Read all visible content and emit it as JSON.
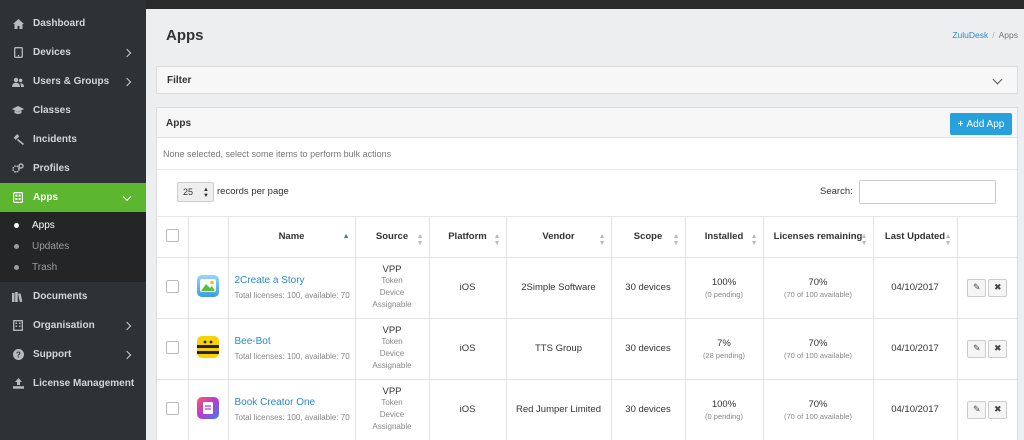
{
  "sidebar": {
    "items": [
      {
        "label": "Dashboard",
        "icon": "home-icon"
      },
      {
        "label": "Devices",
        "icon": "tablet-icon"
      },
      {
        "label": "Users & Groups",
        "icon": "users-icon"
      },
      {
        "label": "Classes",
        "icon": "graduation-cap-icon"
      },
      {
        "label": "Incidents",
        "icon": "gavel-icon"
      },
      {
        "label": "Profiles",
        "icon": "gears-icon"
      },
      {
        "label": "Apps",
        "icon": "apps-icon"
      },
      {
        "label": "Documents",
        "icon": "books-icon"
      },
      {
        "label": "Organisation",
        "icon": "building-icon"
      },
      {
        "label": "Support",
        "icon": "question-circle-icon"
      },
      {
        "label": "License Management",
        "icon": "upload-icon"
      }
    ],
    "sub_items": [
      "Apps",
      "Updates",
      "Trash"
    ]
  },
  "page": {
    "title": "Apps",
    "breadcrumb": {
      "root": "ZuluDesk",
      "current": "Apps"
    }
  },
  "filter": {
    "title": "Filter"
  },
  "apps_panel": {
    "title": "Apps",
    "add_label": "Add App",
    "bulk_text": "None selected, select some items to perform bulk actions",
    "records_per_page": "25",
    "records_label": "records per page",
    "search_label": "Search:",
    "search_value": ""
  },
  "table": {
    "columns": [
      "Name",
      "Source",
      "Platform",
      "Vendor",
      "Scope",
      "Installed",
      "Licenses remaining",
      "Last Updated"
    ],
    "rows": [
      {
        "name": "2Create a Story",
        "meta": "Total licenses: 100, available: 70",
        "source": "VPP",
        "source_sub1": "Token",
        "source_sub2": "Device",
        "source_sub3": "Assignable",
        "platform": "iOS",
        "vendor": "2Simple Software",
        "scope": "30 devices",
        "installed": "100%",
        "installed_sub": "(0 pending)",
        "licenses": "70%",
        "licenses_sub": "(70 of 100 available)",
        "updated": "04/10/2017",
        "icon_color": "#6bb8e8"
      },
      {
        "name": "Bee-Bot",
        "meta": "Total licenses: 100, available: 70",
        "source": "VPP",
        "source_sub1": "Token",
        "source_sub2": "Device",
        "source_sub3": "Assignable",
        "platform": "iOS",
        "vendor": "TTS Group",
        "scope": "30 devices",
        "installed": "7%",
        "installed_sub": "(28 pending)",
        "licenses": "70%",
        "licenses_sub": "(70 of 100 available)",
        "updated": "04/10/2017",
        "icon_color": "#f5d000"
      },
      {
        "name": "Book Creator One",
        "meta": "Total licenses: 100, available: 70",
        "source": "VPP",
        "source_sub1": "Token",
        "source_sub2": "Device",
        "source_sub3": "Assignable",
        "platform": "iOS",
        "vendor": "Red Jumper Limited",
        "scope": "30 devices",
        "installed": "100%",
        "installed_sub": "(0 pending)",
        "licenses": "70%",
        "licenses_sub": "(70 of 100 available)",
        "updated": "04/10/2017",
        "icon_color": "#e24a8b"
      }
    ]
  },
  "colors": {
    "sidebar_bg": "#2f3234",
    "active_green": "#5cb630",
    "accent_blue": "#27a1dc",
    "link_blue": "#2a8ac7"
  }
}
